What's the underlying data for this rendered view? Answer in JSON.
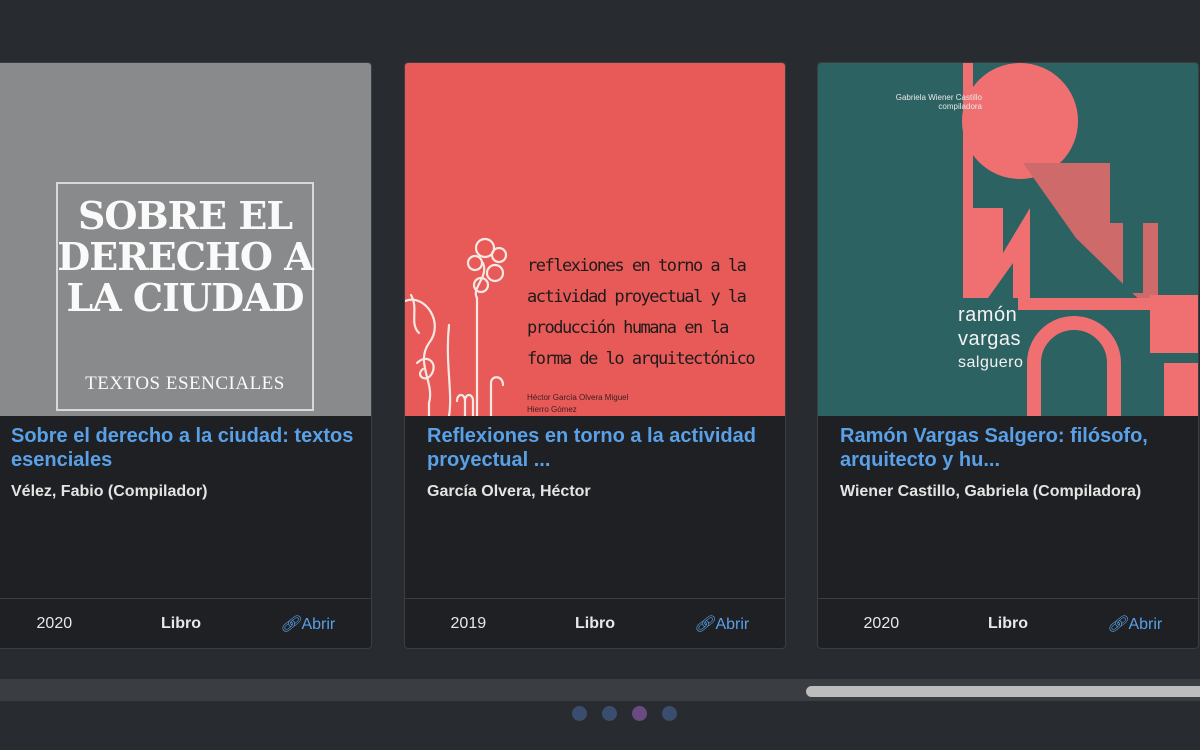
{
  "books": [
    {
      "title": "Sobre el derecho a la ciudad: textos esenciales",
      "author": "Vélez, Fabio (Compilador)",
      "year": "2020",
      "type": "Libro",
      "open_label": "Abrir",
      "cover": {
        "title": "SOBRE EL DERECHO A LA CIUDAD",
        "subtitle": "TEXTOS ESENCIALES",
        "color": "#888a8c"
      }
    },
    {
      "title": "Reflexiones en torno a la actividad proyectual ...",
      "author": "García Olvera, Héctor",
      "year": "2019",
      "type": "Libro",
      "open_label": "Abrir",
      "cover": {
        "title": "reflexiones en torno a la actividad proyectual y la producción humana en la forma de lo arquitectónico",
        "authors": "Héctor García Olvera Miguel Hierro Gómez",
        "color": "#e85a58"
      }
    },
    {
      "title": "Ramón Vargas Salgero: filósofo, arquitecto y hu...",
      "author": "Wiener Castillo, Gabriela (Compiladora)",
      "year": "2020",
      "type": "Libro",
      "open_label": "Abrir",
      "cover": {
        "editor": "Gabriela Wiener Castillo compiladora",
        "name_line1": "ramón",
        "name_line2": "vargas",
        "name_line3": "salguero",
        "color": "#2d6262",
        "accent": "#f07072"
      }
    }
  ],
  "carousel": {
    "page_count": 4,
    "active_page": 3
  },
  "colors": {
    "background": "#282b30",
    "card": "#1e2023",
    "link": "#5aa0e6"
  }
}
